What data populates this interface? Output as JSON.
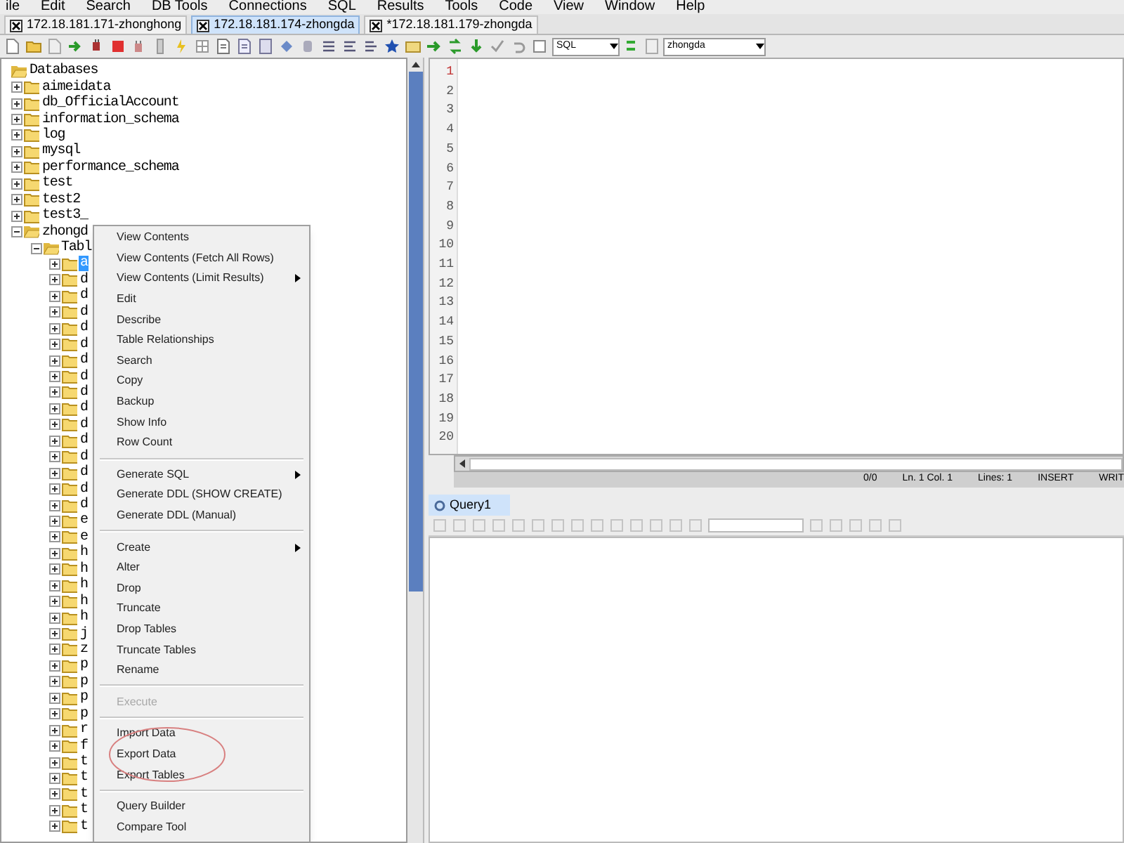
{
  "menu_bar": [
    "ile",
    "Edit",
    "Search",
    "DB Tools",
    "Connections",
    "SQL",
    "Results",
    "Tools",
    "Code",
    "View",
    "Window",
    "Help"
  ],
  "connection_tabs": [
    {
      "label": "172.18.181.171-zhonghong",
      "selected": false
    },
    {
      "label": "172.18.181.174-zhongda",
      "selected": true
    },
    {
      "label": "*172.18.181.179-zhongda",
      "selected": false
    }
  ],
  "toolbar": {
    "language": "SQL",
    "database": "zhongda"
  },
  "tree": {
    "label": "Databases",
    "expanded": true,
    "children": [
      {
        "label": "aimeidata",
        "expanded": false
      },
      {
        "label": "db_OfficialAccount",
        "expanded": false
      },
      {
        "label": "information_schema",
        "expanded": false
      },
      {
        "label": "log",
        "expanded": false
      },
      {
        "label": "mysql",
        "expanded": false
      },
      {
        "label": "performance_schema",
        "expanded": false
      },
      {
        "label": "test",
        "expanded": false
      },
      {
        "label": "test2",
        "expanded": false
      },
      {
        "label": "test3_",
        "expanded": false
      },
      {
        "label": "zhongd",
        "expanded": true,
        "children": [
          {
            "label": "Tabl",
            "expanded": true,
            "children": [
              {
                "label": "a",
                "selected": true
              },
              {
                "label": "d",
                "selected": false
              },
              {
                "label": "d",
                "selected": false
              },
              {
                "label": "d",
                "selected": false
              },
              {
                "label": "d",
                "selected": false
              },
              {
                "label": "d",
                "selected": false
              },
              {
                "label": "d",
                "selected": false
              },
              {
                "label": "d",
                "selected": false
              },
              {
                "label": "d",
                "selected": false
              },
              {
                "label": "d",
                "selected": false
              },
              {
                "label": "d",
                "selected": false
              },
              {
                "label": "d",
                "selected": false
              },
              {
                "label": "d",
                "selected": false
              },
              {
                "label": "d",
                "selected": false
              },
              {
                "label": "d",
                "selected": false
              },
              {
                "label": "d",
                "selected": false
              },
              {
                "label": "e",
                "selected": false
              },
              {
                "label": "e",
                "selected": false
              },
              {
                "label": "h",
                "selected": false
              },
              {
                "label": "h",
                "selected": false
              },
              {
                "label": "h",
                "selected": false
              },
              {
                "label": "h",
                "selected": false
              },
              {
                "label": "h",
                "selected": false
              },
              {
                "label": "j",
                "selected": false
              },
              {
                "label": "z",
                "selected": false
              },
              {
                "label": "p",
                "selected": false
              },
              {
                "label": "p",
                "selected": false
              },
              {
                "label": "p",
                "selected": false
              },
              {
                "label": "p",
                "selected": false
              },
              {
                "label": "r",
                "selected": false
              },
              {
                "label": "f",
                "selected": false
              },
              {
                "label": "t",
                "selected": false
              },
              {
                "label": "t",
                "selected": false
              },
              {
                "label": "t",
                "selected": false
              },
              {
                "label": "t",
                "selected": false
              },
              {
                "label": "t",
                "selected": false
              }
            ]
          }
        ]
      }
    ]
  },
  "context_menu": [
    {
      "kind": "item",
      "label": "View Contents",
      "disabled": false,
      "submenu": false
    },
    {
      "kind": "item",
      "label": "View Contents (Fetch All Rows)",
      "disabled": false,
      "submenu": false
    },
    {
      "kind": "item",
      "label": "View Contents (Limit Results)",
      "disabled": false,
      "submenu": true
    },
    {
      "kind": "item",
      "label": "Edit",
      "disabled": false,
      "submenu": false
    },
    {
      "kind": "item",
      "label": "Describe",
      "disabled": false,
      "submenu": false
    },
    {
      "kind": "item",
      "label": "Table Relationships",
      "disabled": false,
      "submenu": false
    },
    {
      "kind": "item",
      "label": "Search",
      "disabled": false,
      "submenu": false
    },
    {
      "kind": "item",
      "label": "Copy",
      "disabled": false,
      "submenu": false
    },
    {
      "kind": "item",
      "label": "Backup",
      "disabled": false,
      "submenu": false
    },
    {
      "kind": "item",
      "label": "Show Info",
      "disabled": false,
      "submenu": false
    },
    {
      "kind": "item",
      "label": "Row Count",
      "disabled": false,
      "submenu": false
    },
    {
      "kind": "separator"
    },
    {
      "kind": "item",
      "label": "Generate SQL",
      "disabled": false,
      "submenu": true
    },
    {
      "kind": "item",
      "label": "Generate DDL (SHOW CREATE)",
      "disabled": false,
      "submenu": false
    },
    {
      "kind": "item",
      "label": "Generate DDL (Manual)",
      "disabled": false,
      "submenu": false
    },
    {
      "kind": "separator"
    },
    {
      "kind": "item",
      "label": "Create",
      "disabled": false,
      "submenu": true
    },
    {
      "kind": "item",
      "label": "Alter",
      "disabled": false,
      "submenu": false
    },
    {
      "kind": "item",
      "label": "Drop",
      "disabled": false,
      "submenu": false
    },
    {
      "kind": "item",
      "label": "Truncate",
      "disabled": false,
      "submenu": false
    },
    {
      "kind": "item",
      "label": "Drop Tables",
      "disabled": false,
      "submenu": false
    },
    {
      "kind": "item",
      "label": "Truncate Tables",
      "disabled": false,
      "submenu": false
    },
    {
      "kind": "item",
      "label": "Rename",
      "disabled": false,
      "submenu": false
    },
    {
      "kind": "separator"
    },
    {
      "kind": "item",
      "label": "Execute",
      "disabled": true,
      "submenu": false
    },
    {
      "kind": "separator"
    },
    {
      "kind": "item",
      "label": "Import Data",
      "disabled": false,
      "submenu": false
    },
    {
      "kind": "item",
      "label": "Export Data",
      "disabled": false,
      "submenu": false
    },
    {
      "kind": "item",
      "label": "Export Tables",
      "disabled": false,
      "submenu": false
    },
    {
      "kind": "separator"
    },
    {
      "kind": "item",
      "label": "Query Builder",
      "disabled": false,
      "submenu": false
    },
    {
      "kind": "item",
      "label": "Compare Tool",
      "disabled": false,
      "submenu": false
    }
  ],
  "editor": {
    "line_numbers": [
      "1",
      "2",
      "3",
      "4",
      "5",
      "6",
      "7",
      "8",
      "9",
      "10",
      "11",
      "12",
      "13",
      "14",
      "15",
      "16",
      "17",
      "18",
      "19",
      "20"
    ],
    "status": [
      "0/0",
      "Ln. 1 Col. 1",
      "Lines: 1",
      "INSERT",
      "WRIT"
    ]
  },
  "result_tabs": [
    {
      "label": "Query1",
      "selected": true
    }
  ]
}
